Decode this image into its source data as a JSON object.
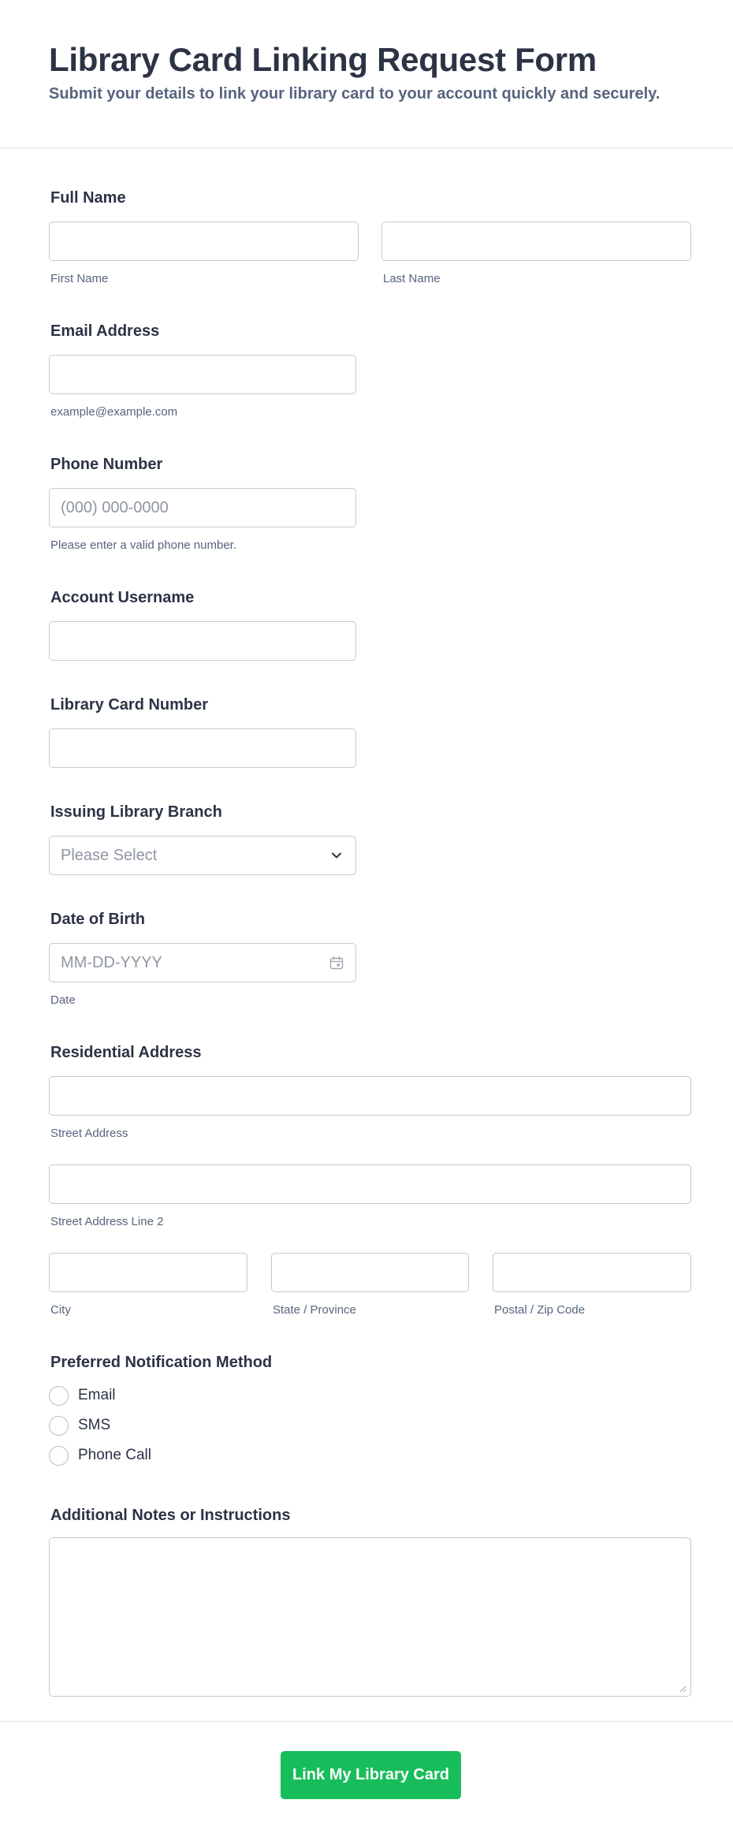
{
  "header": {
    "title": "Library Card Linking Request Form",
    "subtitle": "Submit your details to link your library card to your account quickly and securely."
  },
  "full_name": {
    "label": "Full Name",
    "first_value": "",
    "first_sublabel": "First Name",
    "last_value": "",
    "last_sublabel": "Last Name"
  },
  "email": {
    "label": "Email Address",
    "value": "",
    "sublabel": "example@example.com"
  },
  "phone": {
    "label": "Phone Number",
    "value": "",
    "placeholder": "(000) 000-0000",
    "sublabel": "Please enter a valid phone number."
  },
  "username": {
    "label": "Account Username",
    "value": ""
  },
  "card_number": {
    "label": "Library Card Number",
    "value": ""
  },
  "branch": {
    "label": "Issuing Library Branch",
    "selected": "Please Select",
    "icon": "chevron-down-icon"
  },
  "dob": {
    "label": "Date of Birth",
    "placeholder": "MM-DD-YYYY",
    "sublabel": "Date",
    "icon": "calendar-icon"
  },
  "address": {
    "label": "Residential Address",
    "street_sublabel": "Street Address",
    "street2_sublabel": "Street Address Line 2",
    "city_sublabel": "City",
    "state_sublabel": "State / Province",
    "zip_sublabel": "Postal / Zip Code"
  },
  "notification": {
    "label": "Preferred Notification Method",
    "options": [
      "Email",
      "SMS",
      "Phone Call"
    ]
  },
  "notes": {
    "label": "Additional Notes or Instructions",
    "value": ""
  },
  "submit": {
    "label": "Link My Library Card",
    "color": "#18bd5b"
  },
  "colors": {
    "text_primary": "#2c3345",
    "text_secondary": "#57647e",
    "border": "#c3cad8",
    "placeholder": "#8f96a3"
  }
}
